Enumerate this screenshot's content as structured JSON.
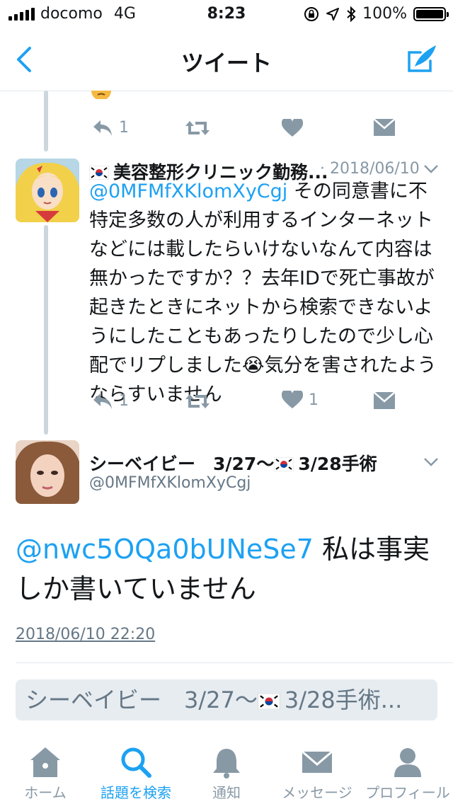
{
  "status": {
    "carrier": "docomo",
    "network": "4G",
    "time": "8:23",
    "battery": "100%"
  },
  "nav": {
    "title": "ツイート"
  },
  "prev_actions": {
    "reply_count": "1"
  },
  "reply_tweet": {
    "name": "美容整形クリニック勤務...",
    "date": "· 2018/06/10",
    "mention": "@0MFMfXKlomXyCgj",
    "text": "その同意書に不特定多数の人が利用するインターネットなどには載したらいけないなんて内容は無かったですか？？去年IDで死亡事故が起きたときにネットから検索できないようにしたこともあったりしたので少し心配でリプしました😭気分を害されたようならすいません",
    "reply_count": "1",
    "like_count": "1"
  },
  "main_tweet": {
    "name": "シーベイビー　3/27〜",
    "name_suffix": "3/28手術",
    "handle": "@0MFMfXKlomXyCgj",
    "mention": "@nwc5OQa0bUNeSe7",
    "text": "私は事実しか書いていません",
    "timestamp": "2018/06/10 22:20"
  },
  "reply_box": {
    "prefix": "シーベイビー　3/27〜",
    "suffix": "3/28手術..."
  },
  "tabs": [
    {
      "label": "ホーム",
      "icon": "home-icon"
    },
    {
      "label": "話題を検索",
      "icon": "search-icon"
    },
    {
      "label": "通知",
      "icon": "bell-icon"
    },
    {
      "label": "メッセージ",
      "icon": "envelope-icon"
    },
    {
      "label": "プロフィール",
      "icon": "person-icon"
    }
  ],
  "colors": {
    "accent": "#1da1f2",
    "muted": "#8899a6",
    "thread": "#ccd6dd"
  }
}
